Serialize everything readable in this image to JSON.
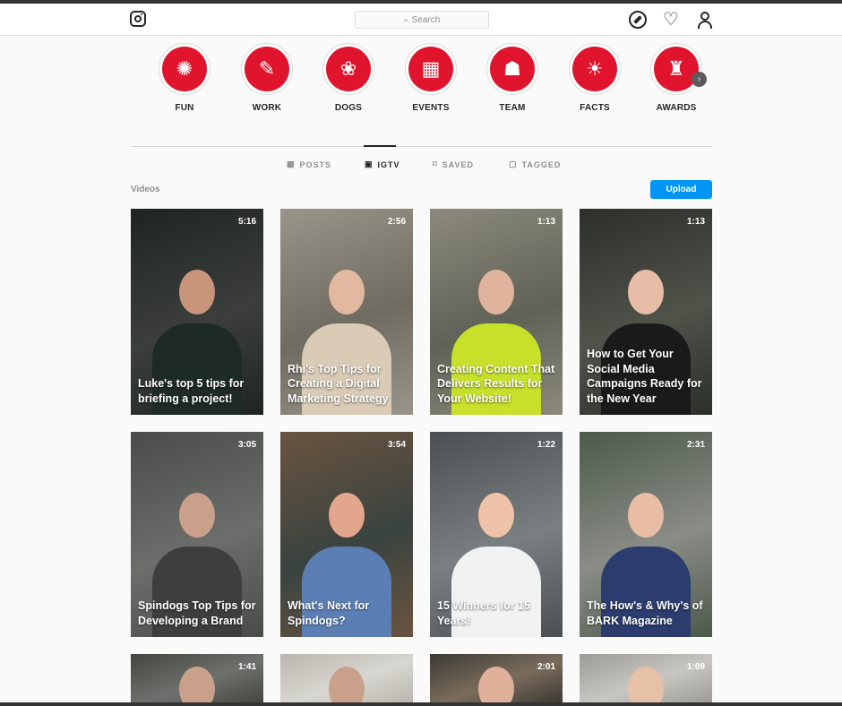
{
  "header": {
    "search_placeholder": "Search",
    "icons": [
      "instagram-logo",
      "compass-icon",
      "heart-icon",
      "user-icon"
    ]
  },
  "highlights": [
    {
      "label": "FUN",
      "icon": "party-popper-icon",
      "glyph": "✺"
    },
    {
      "label": "WORK",
      "icon": "document-pen-icon",
      "glyph": "✎"
    },
    {
      "label": "DOGS",
      "icon": "dog-icon",
      "glyph": "❀"
    },
    {
      "label": "EVENTS",
      "icon": "calendar-icon",
      "glyph": "▦"
    },
    {
      "label": "TEAM",
      "icon": "team-icon",
      "glyph": "☗"
    },
    {
      "label": "FACTS",
      "icon": "lightbulb-icon",
      "glyph": "☀"
    },
    {
      "label": "AWARDS",
      "icon": "trophy-icon",
      "glyph": "♜"
    }
  ],
  "tabs": [
    {
      "label": "POSTS",
      "icon": "grid-icon",
      "glyph": "▦"
    },
    {
      "label": "IGTV",
      "icon": "igtv-icon",
      "glyph": "▣",
      "active": true
    },
    {
      "label": "SAVED",
      "icon": "bookmark-icon",
      "glyph": "⌑"
    },
    {
      "label": "TAGGED",
      "icon": "tag-person-icon",
      "glyph": "▢"
    }
  ],
  "section": {
    "label": "Videos",
    "upload_label": "Upload"
  },
  "videos": [
    {
      "duration": "5:16",
      "title": "Luke's top 5 tips for briefing a project!",
      "bg": "#3b3e3d",
      "bg2": "#1f2422",
      "skin": "#c9957a",
      "shirt": "#1e2a26"
    },
    {
      "duration": "2:56",
      "title": "Rhi's Top Tips for Creating a Digital Marketing Strategy",
      "bg": "#6f6b60",
      "bg2": "#9a958a",
      "skin": "#e2b8a0",
      "shirt": "#d9cbb6"
    },
    {
      "duration": "1:13",
      "title": "Creating Content That Delivers Results for Your Website!",
      "bg": "#5f6256",
      "bg2": "#8c8a7c",
      "skin": "#e0b39d",
      "shirt": "#c7e02a"
    },
    {
      "duration": "1:13",
      "title": "How to Get Your Social Media Campaigns Ready for the New Year",
      "bg": "#4f534a",
      "bg2": "#2c2f2a",
      "skin": "#e7bda8",
      "shirt": "#1a1a1a"
    },
    {
      "duration": "3:05",
      "title": "Spindogs Top Tips for Developing a Brand",
      "bg": "#6c6e6b",
      "bg2": "#4a4c4a",
      "skin": "#caa08a",
      "shirt": "#3d3f3d"
    },
    {
      "duration": "3:54",
      "title": "What's Next for Spindogs?",
      "bg": "#3a4340",
      "bg2": "#6a5440",
      "skin": "#e2a68c",
      "shirt": "#5b7fb5"
    },
    {
      "duration": "1:22",
      "title": "15 Winners for 15 Years!",
      "bg": "#7a7f82",
      "bg2": "#4c4f51",
      "skin": "#efc3a8",
      "shirt": "#f2f2f2"
    },
    {
      "duration": "2:31",
      "title": "The How's & Why's of BARK Magazine",
      "bg": "#8a8c87",
      "bg2": "#4c5a4a",
      "skin": "#e9bda4",
      "shirt": "#2c3c6e"
    },
    {
      "duration": "1:41",
      "title": "",
      "bg": "#6d706c",
      "bg2": "#44463f",
      "skin": "#c9a08a",
      "shirt": "#444"
    },
    {
      "duration": "",
      "title": "",
      "bg": "#d8d6d0",
      "bg2": "#b8b6ae",
      "skin": "#c9a08a",
      "shirt": "#444"
    },
    {
      "duration": "2:01",
      "title": "",
      "bg": "#7a6c5c",
      "bg2": "#3c3a34",
      "skin": "#e0b09a",
      "shirt": "#444"
    },
    {
      "duration": "1:09",
      "title": "",
      "bg": "#c7c6c1",
      "bg2": "#9c9b96",
      "skin": "#e7c0a8",
      "shirt": "#444"
    }
  ]
}
